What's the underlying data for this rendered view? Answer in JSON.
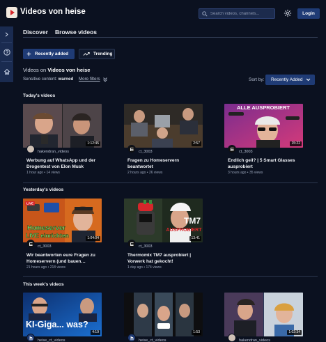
{
  "app": {
    "title": "Videos von heise",
    "brand_color": "#d7262b"
  },
  "header": {
    "search_placeholder": "Search videos, channels...",
    "login_label": "Login",
    "settings_icon": "gear-icon"
  },
  "sidebar": {
    "icons": [
      "chevron-right-icon",
      "help-icon",
      "home-icon"
    ]
  },
  "tabs": [
    "Discover",
    "Browse videos"
  ],
  "filters": {
    "recently_added": "Recently added",
    "trending": "Trending"
  },
  "listing": {
    "videos_on_prefix": "Videos on",
    "videos_on_name": "Videos von heise",
    "sensitive_label": "Sensitive content:",
    "sensitive_value": "warned",
    "more_filters": "More filters",
    "sort_label": "Sort by:",
    "sort_value": "Recently Added"
  },
  "sections": [
    {
      "title": "Today's videos",
      "videos": [
        {
          "channel": "hakendran_videos",
          "duration": "1:12:45",
          "title": "Werbung auf WhatsApp und der Drogentest von Elon Musk",
          "meta": "1 hour ago • 14 views"
        },
        {
          "channel": "ct_3003",
          "duration": "2:57",
          "title": "Fragen zu Homeservern beantwortet",
          "meta": "2 hours ago • 26 views"
        },
        {
          "channel": "ct_3003",
          "duration": "15:22",
          "title": "Endlich geil? | 5 Smart Glasses ausprobiert",
          "meta": "3 hours ago • 35 views"
        }
      ]
    },
    {
      "title": "Yesterday's videos",
      "videos": [
        {
          "channel": "ct_3003",
          "duration": "1:04:04",
          "title": "Wir beantworten eure Fragen zu Homeservern (und bauen…",
          "meta": "21 hours ago • 218 views"
        },
        {
          "channel": "ct_3003",
          "duration": "13:41",
          "title": "Thermomix TM7 ausprobiert | Vorwerk hat gekocht!",
          "meta": "1 day ago • 174 views"
        }
      ]
    },
    {
      "title": "This week's videos",
      "videos": [
        {
          "channel": "heise_ct_videos",
          "duration": "4:19",
          "title": "",
          "meta": ""
        },
        {
          "channel": "heise_ct_videos",
          "duration": "1:53",
          "title": "",
          "meta": ""
        },
        {
          "channel": "hakendran_videos",
          "duration": "1:02:34",
          "title": "",
          "meta": ""
        }
      ]
    }
  ],
  "thumb_text": {
    "smartglasses": "ALLE AUSPROBIERT",
    "homeserver_1": "Homeserver",
    "homeserver_2": "LIVE einrichten",
    "thermomix_1": "TM7",
    "thermomix_2": "AUSPROBIERT",
    "ki": "KI-Giga... was?",
    "live": "LIVE"
  }
}
